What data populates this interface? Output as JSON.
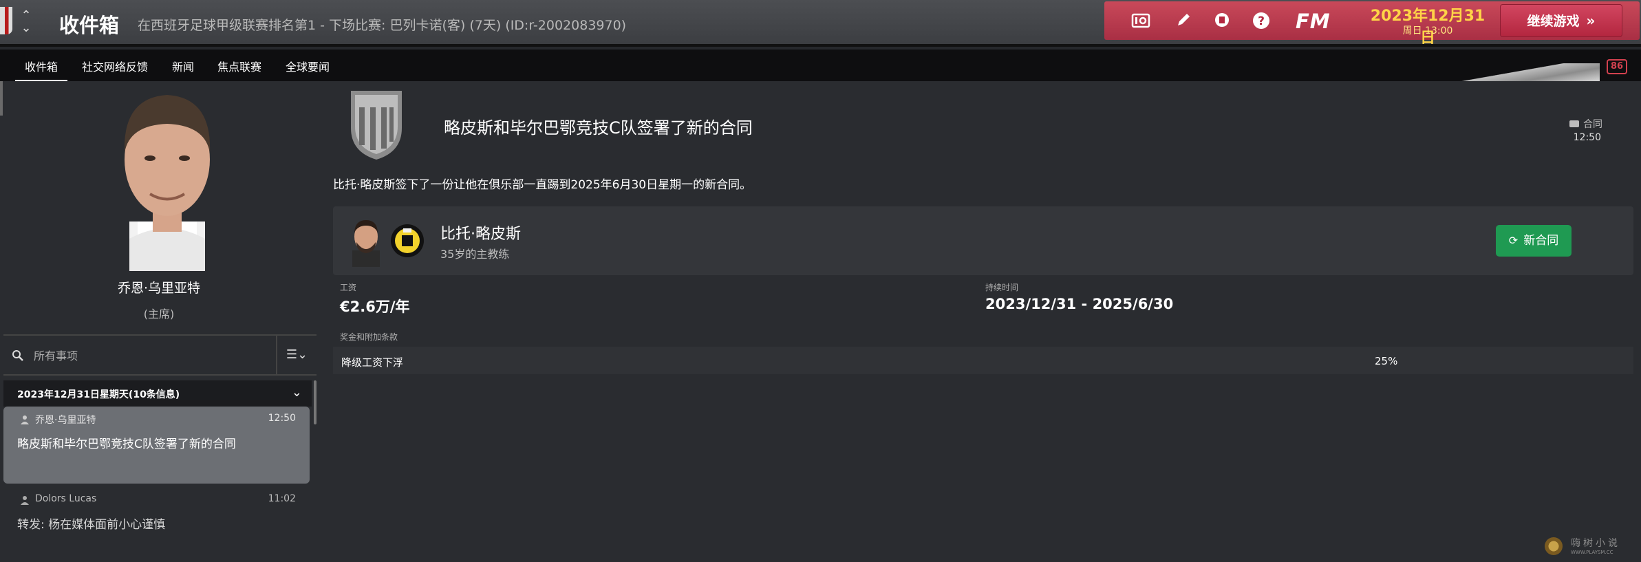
{
  "header": {
    "title": "收件箱",
    "status": "在西班牙足球甲级联赛排名第1 - 下场比赛: 巴列卡诺(客) (7天) (ID:r-2002083970)",
    "date": "2023年12月31日",
    "time": "周日 13:00",
    "continue_label": "继续游戏",
    "fm_logo": "FM",
    "fm_badge": "86"
  },
  "tabs": [
    {
      "label": "收件箱",
      "active": true
    },
    {
      "label": "社交网络反馈"
    },
    {
      "label": "新闻"
    },
    {
      "label": "焦点联赛"
    },
    {
      "label": "全球要闻"
    }
  ],
  "sidebar": {
    "person_name": "乔恩·乌里亚特",
    "person_role": "(主席)",
    "search_placeholder": "所有事项",
    "filter_icon": "list-filter-icon",
    "group_header": "2023年12月31日星期天(10条信息)",
    "items": [
      {
        "sender": "乔恩·乌里亚特",
        "time": "12:50",
        "subject": "略皮斯和毕尔巴鄂竞技C队签署了新的合同",
        "selected": true
      },
      {
        "sender": "Dolors Lucas",
        "time": "11:02",
        "subject": "转发: 杨在媒体面前小心谨慎",
        "selected": false
      }
    ]
  },
  "message": {
    "title": "略皮斯和毕尔巴鄂竞技C队签署了新的合同",
    "tag": "合同",
    "time": "12:50",
    "body": "比托·略皮斯签下了一份让他在俱乐部一直踢到2025年6月30日星期一的新合同。",
    "card": {
      "name": "比托·略皮斯",
      "subtitle": "35岁的主教练",
      "button": "新合同"
    },
    "salary_label": "工资",
    "salary_value": "€2.6万/年",
    "duration_label": "持续时间",
    "duration_value": "2023/12/31 - 2025/6/30",
    "clauses_label": "奖金和附加条款",
    "clauses": [
      {
        "name": "降级工资下浮",
        "value": "25%"
      }
    ]
  },
  "watermark": {
    "text": "嗨树小说",
    "url": "WWW.PLAYSM.CC"
  },
  "colors": {
    "accent_red": "#b3263f",
    "date_gold": "#ffd447",
    "button_green": "#1f9a52"
  }
}
